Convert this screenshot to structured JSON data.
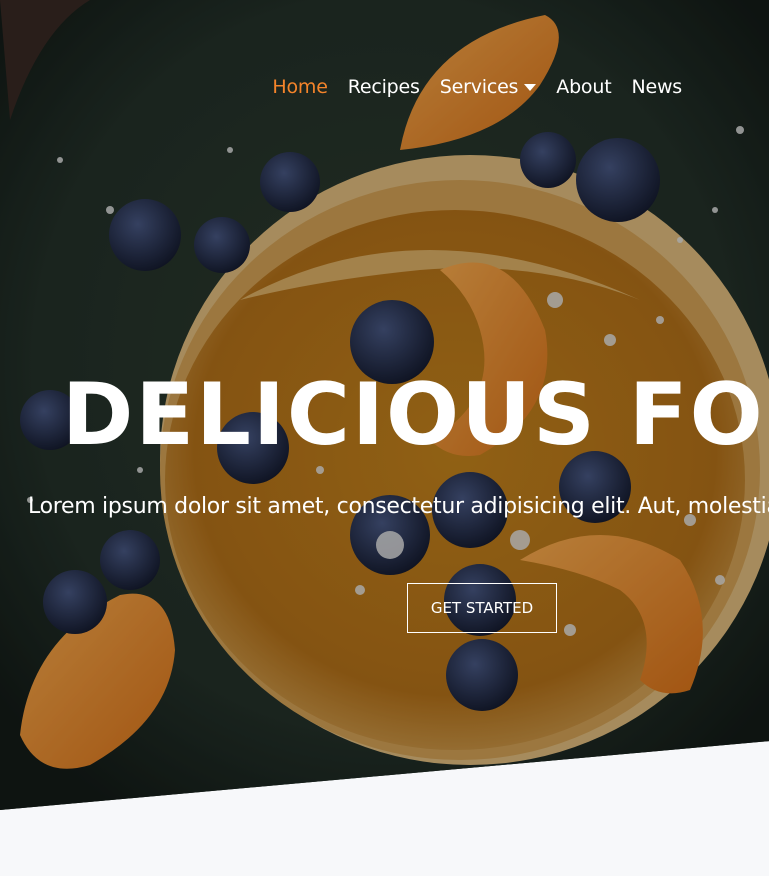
{
  "nav": {
    "items": [
      {
        "label": "Home",
        "active": true
      },
      {
        "label": "Recipes"
      },
      {
        "label": "Services",
        "has_dropdown": true
      },
      {
        "label": "About"
      },
      {
        "label": "News"
      }
    ]
  },
  "hero": {
    "title": "DELICIOUS FOOD",
    "subtitle": "Lorem ipsum dolor sit amet, consectetur adipisicing elit. Aut, molestias.",
    "cta_label": "GET STARTED",
    "image_alt_icon": "pancakes-photo"
  },
  "colors": {
    "accent": "#f5842a",
    "overlay_text": "#ffffff",
    "page_bg": "#f7f8fa"
  }
}
